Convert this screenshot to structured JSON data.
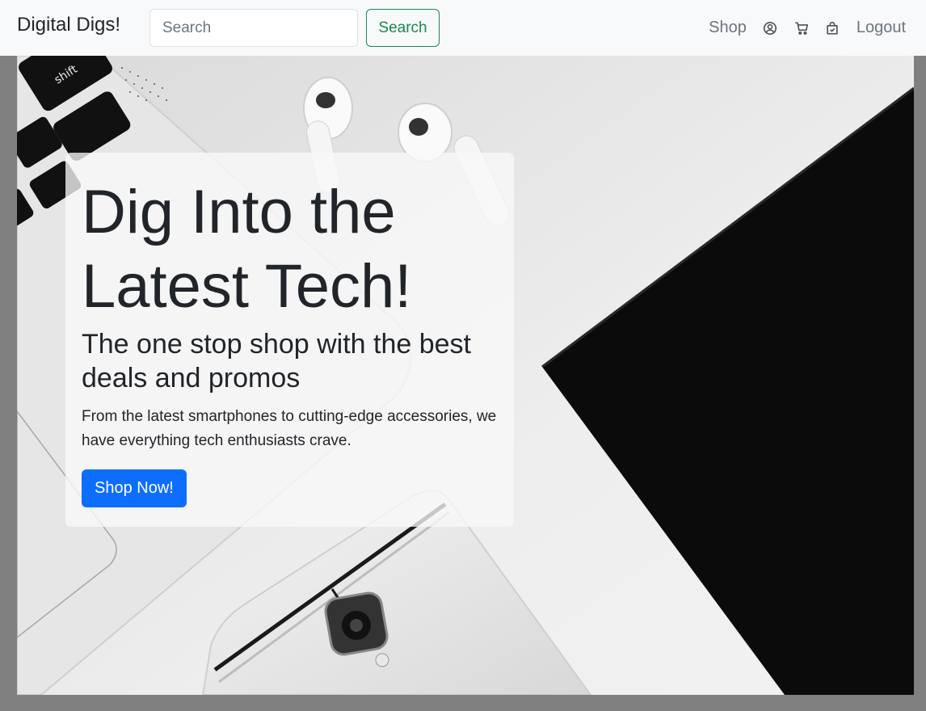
{
  "navbar": {
    "brand": "Digital Digs!",
    "search_placeholder": "Search",
    "search_value": "",
    "search_button": "Search",
    "links": {
      "shop": "Shop",
      "logout": "Logout"
    },
    "icons": [
      "user-circle-icon",
      "cart-icon",
      "shopping-bag-check-icon"
    ]
  },
  "hero": {
    "title": "Dig Into the Latest Tech!",
    "subtitle": "The one stop shop with the best deals and promos",
    "text": "From the latest smartphones to cutting-edge accessories, we have everything tech enthusiasts crave.",
    "cta": "Shop Now!",
    "image_description_keys": [
      "laptop-keyboard",
      "earbuds",
      "smartphone",
      "black-notebook"
    ]
  },
  "colors": {
    "navbar_bg": "#f8f9fa",
    "search_button": "#198754",
    "cta": "#0d6efd",
    "page_bg": "#808080"
  }
}
